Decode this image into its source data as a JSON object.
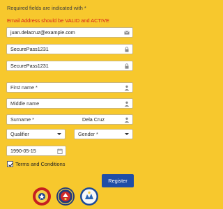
{
  "notice": {
    "required": "Required fields are indicated with *",
    "email_warning": "Email Address should be VALID and ACTIVE"
  },
  "fields": {
    "email": {
      "value": "juan.delacruz@example.com",
      "icon": "envelope-icon"
    },
    "password": {
      "value": "SecurePass1231",
      "icon": "lock-icon"
    },
    "confirm_password": {
      "value": "SecurePass1231",
      "icon": "lock-icon"
    },
    "first_name": {
      "placeholder": "First name *",
      "icon": "person-icon"
    },
    "middle_name": {
      "placeholder": "Middle name",
      "icon": "person-icon"
    },
    "surname": {
      "label": "Surname *",
      "value": "Dela Cruz",
      "icon": "person-icon"
    },
    "qualifier": {
      "selected": "Qualifier"
    },
    "gender": {
      "selected": "Gender *"
    },
    "birthdate": {
      "value": "1990-05-15",
      "icon": "calendar-icon"
    }
  },
  "terms": {
    "label": "Terms and Conditions",
    "checked": true
  },
  "actions": {
    "register_label": "Register"
  },
  "colors": {
    "background": "#f7c82d",
    "warning": "#d71a1a",
    "primary": "#1f4ea6"
  },
  "seals": [
    "seal-1",
    "seal-2",
    "seal-3"
  ]
}
